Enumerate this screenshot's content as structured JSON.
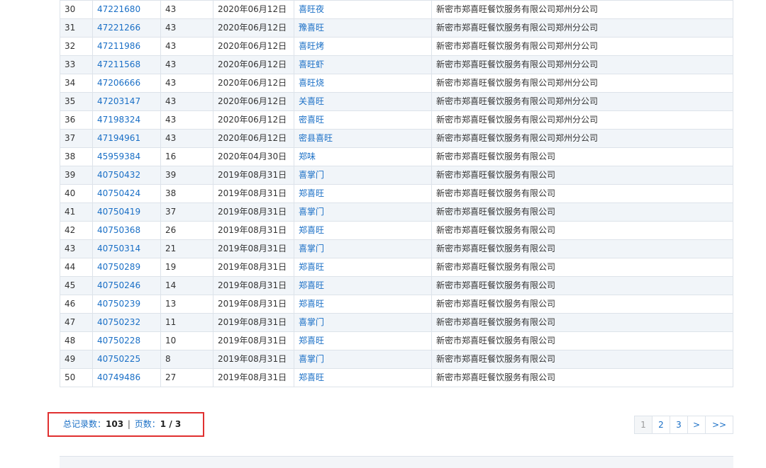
{
  "table": {
    "partial_top_row": [
      "",
      "",
      "",
      "",
      "",
      ""
    ],
    "rows": [
      {
        "idx": "30",
        "reg": "47221680",
        "cls": "43",
        "date": "2020年06月12日",
        "name": "喜旺夜",
        "applicant": "新密市郑喜旺餐饮服务有限公司郑州分公司"
      },
      {
        "idx": "31",
        "reg": "47221266",
        "cls": "43",
        "date": "2020年06月12日",
        "name": "豫喜旺",
        "applicant": "新密市郑喜旺餐饮服务有限公司郑州分公司"
      },
      {
        "idx": "32",
        "reg": "47211986",
        "cls": "43",
        "date": "2020年06月12日",
        "name": "喜旺烤",
        "applicant": "新密市郑喜旺餐饮服务有限公司郑州分公司"
      },
      {
        "idx": "33",
        "reg": "47211568",
        "cls": "43",
        "date": "2020年06月12日",
        "name": "喜旺虾",
        "applicant": "新密市郑喜旺餐饮服务有限公司郑州分公司"
      },
      {
        "idx": "34",
        "reg": "47206666",
        "cls": "43",
        "date": "2020年06月12日",
        "name": "喜旺烧",
        "applicant": "新密市郑喜旺餐饮服务有限公司郑州分公司"
      },
      {
        "idx": "35",
        "reg": "47203147",
        "cls": "43",
        "date": "2020年06月12日",
        "name": "关喜旺",
        "applicant": "新密市郑喜旺餐饮服务有限公司郑州分公司"
      },
      {
        "idx": "36",
        "reg": "47198324",
        "cls": "43",
        "date": "2020年06月12日",
        "name": "密喜旺",
        "applicant": "新密市郑喜旺餐饮服务有限公司郑州分公司"
      },
      {
        "idx": "37",
        "reg": "47194961",
        "cls": "43",
        "date": "2020年06月12日",
        "name": "密县喜旺",
        "applicant": "新密市郑喜旺餐饮服务有限公司郑州分公司"
      },
      {
        "idx": "38",
        "reg": "45959384",
        "cls": "16",
        "date": "2020年04月30日",
        "name": "郑味",
        "applicant": "新密市郑喜旺餐饮服务有限公司"
      },
      {
        "idx": "39",
        "reg": "40750432",
        "cls": "39",
        "date": "2019年08月31日",
        "name": "喜掌门",
        "applicant": "新密市郑喜旺餐饮服务有限公司"
      },
      {
        "idx": "40",
        "reg": "40750424",
        "cls": "38",
        "date": "2019年08月31日",
        "name": "郑喜旺",
        "applicant": "新密市郑喜旺餐饮服务有限公司"
      },
      {
        "idx": "41",
        "reg": "40750419",
        "cls": "37",
        "date": "2019年08月31日",
        "name": "喜掌门",
        "applicant": "新密市郑喜旺餐饮服务有限公司"
      },
      {
        "idx": "42",
        "reg": "40750368",
        "cls": "26",
        "date": "2019年08月31日",
        "name": "郑喜旺",
        "applicant": "新密市郑喜旺餐饮服务有限公司"
      },
      {
        "idx": "43",
        "reg": "40750314",
        "cls": "21",
        "date": "2019年08月31日",
        "name": "喜掌门",
        "applicant": "新密市郑喜旺餐饮服务有限公司"
      },
      {
        "idx": "44",
        "reg": "40750289",
        "cls": "19",
        "date": "2019年08月31日",
        "name": "郑喜旺",
        "applicant": "新密市郑喜旺餐饮服务有限公司"
      },
      {
        "idx": "45",
        "reg": "40750246",
        "cls": "14",
        "date": "2019年08月31日",
        "name": "郑喜旺",
        "applicant": "新密市郑喜旺餐饮服务有限公司"
      },
      {
        "idx": "46",
        "reg": "40750239",
        "cls": "13",
        "date": "2019年08月31日",
        "name": "郑喜旺",
        "applicant": "新密市郑喜旺餐饮服务有限公司"
      },
      {
        "idx": "47",
        "reg": "40750232",
        "cls": "11",
        "date": "2019年08月31日",
        "name": "喜掌门",
        "applicant": "新密市郑喜旺餐饮服务有限公司"
      },
      {
        "idx": "48",
        "reg": "40750228",
        "cls": "10",
        "date": "2019年08月31日",
        "name": "郑喜旺",
        "applicant": "新密市郑喜旺餐饮服务有限公司"
      },
      {
        "idx": "49",
        "reg": "40750225",
        "cls": "8",
        "date": "2019年08月31日",
        "name": "喜掌门",
        "applicant": "新密市郑喜旺餐饮服务有限公司"
      },
      {
        "idx": "50",
        "reg": "40749486",
        "cls": "27",
        "date": "2019年08月31日",
        "name": "郑喜旺",
        "applicant": "新密市郑喜旺餐饮服务有限公司"
      }
    ]
  },
  "summary": {
    "total_label": "总记录数：",
    "total_value": "103",
    "separator": "|",
    "pages_label": "页数：",
    "pages_value": "1 / 3"
  },
  "pager": {
    "items": [
      "1",
      "2",
      "3",
      ">",
      ">>"
    ],
    "active": "1"
  },
  "colors": {
    "link": "#1a6fc6",
    "highlight_border": "#e03030",
    "row_alt": "#f1f5f9"
  }
}
